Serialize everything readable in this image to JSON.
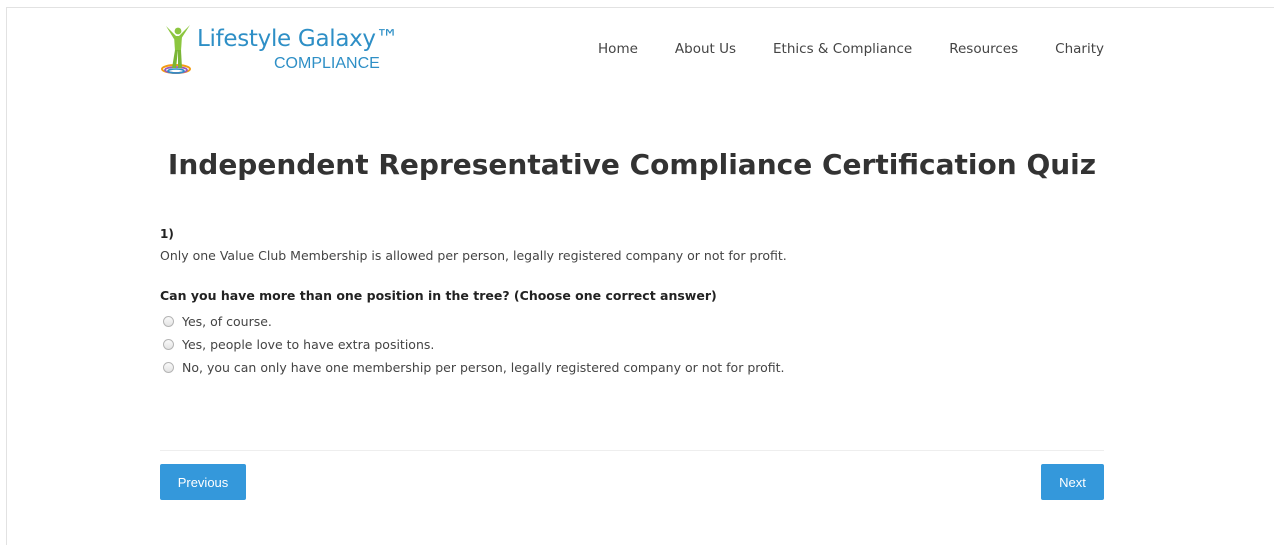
{
  "brand": {
    "name": "Lifestyle Galaxy™",
    "subtitle": "COMPLIANCE",
    "colors": {
      "logo_text": "#2e8fc6",
      "figure_green": "#8cc63f",
      "ring_orange": "#f39c12",
      "ring_blue": "#2e8fc6",
      "ring_purple": "#9b59b6"
    }
  },
  "nav": {
    "items": [
      {
        "label": "Home"
      },
      {
        "label": "About Us"
      },
      {
        "label": "Ethics & Compliance"
      },
      {
        "label": "Resources"
      },
      {
        "label": "Charity"
      }
    ]
  },
  "page": {
    "title": "Independent Representative Compliance Certification Quiz"
  },
  "question": {
    "number": "1)",
    "description": "Only one Value Club Membership is allowed per person, legally registered company or not for profit.",
    "prompt": "Can you have more than one position in the tree? (Choose one correct answer)",
    "options": [
      {
        "label": "Yes, of course.",
        "selected": false
      },
      {
        "label": "Yes, people love to have extra positions.",
        "selected": false
      },
      {
        "label": "No, you can only have one membership per person, legally registered company or not for profit.",
        "selected": false
      }
    ]
  },
  "footer": {
    "previous_label": "Previous",
    "next_label": "Next",
    "button_color": "#3498db"
  }
}
